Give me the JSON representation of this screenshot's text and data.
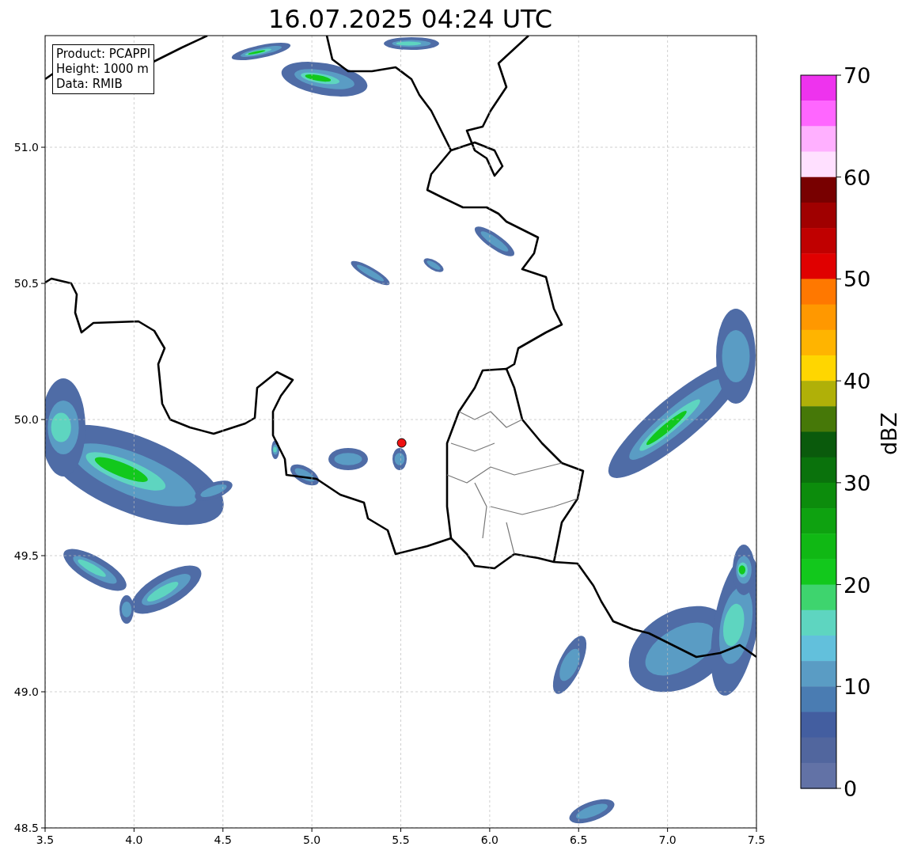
{
  "title": "16.07.2025 04:24 UTC",
  "info_box": [
    "Product: PCAPPI",
    "Height: 1000 m",
    "Data: RMIB"
  ],
  "map": {
    "chart_data": {
      "type": "scatter",
      "grid": true,
      "xlim": [
        3.5,
        7.5
      ],
      "ylim": [
        48.5,
        51.41
      ],
      "xticks": [
        3.5,
        {
          "value": 4,
          "label": "4.0"
        },
        4.5,
        {
          "value": 5,
          "label": "5.0"
        },
        5.5,
        {
          "value": 6,
          "label": "6.0"
        },
        6.5,
        {
          "value": 7,
          "label": "7.0"
        },
        7.5
      ],
      "yticks": [
        48.5,
        {
          "value": 49,
          "label": "49.0"
        },
        49.5,
        {
          "value": 50,
          "label": "50.0"
        },
        50.5,
        {
          "value": 51,
          "label": "51.0"
        }
      ],
      "x": [
        5.505
      ],
      "series": [
        {
          "color": "#ee1111",
          "values": [
            49.914
          ]
        }
      ]
    }
  },
  "colorbar": {
    "label": "dBZ",
    "ticks": [
      "70",
      "60",
      "50",
      "40",
      "30",
      "20",
      "10",
      "0"
    ],
    "bands": [
      {
        "color": "#ee33ee"
      },
      {
        "color": "#ff66ff"
      },
      {
        "color": "#ffb0ff"
      },
      {
        "color": "#ffe0ff"
      },
      {
        "color": "#780000"
      },
      {
        "color": "#a00000"
      },
      {
        "color": "#c00000"
      },
      {
        "color": "#e00000"
      },
      {
        "color": "#ff7800"
      },
      {
        "color": "#ff9800"
      },
      {
        "color": "#ffb400"
      },
      {
        "color": "#ffd600"
      },
      {
        "color": "#b0b008"
      },
      {
        "color": "#467808"
      },
      {
        "color": "#0a5a0c"
      },
      {
        "color": "#0a720c"
      },
      {
        "color": "#0c8c0c"
      },
      {
        "color": "#0ea210"
      },
      {
        "color": "#10b814"
      },
      {
        "color": "#12c81c"
      },
      {
        "color": "#3ed46e"
      },
      {
        "color": "#5ed5c0"
      },
      {
        "color": "#62c0dc"
      },
      {
        "color": "#5a9cc4"
      },
      {
        "color": "#4a7cb2"
      },
      {
        "color": "#435ea0"
      },
      {
        "color": "#51669e"
      },
      {
        "color": "#6272a6"
      }
    ]
  }
}
